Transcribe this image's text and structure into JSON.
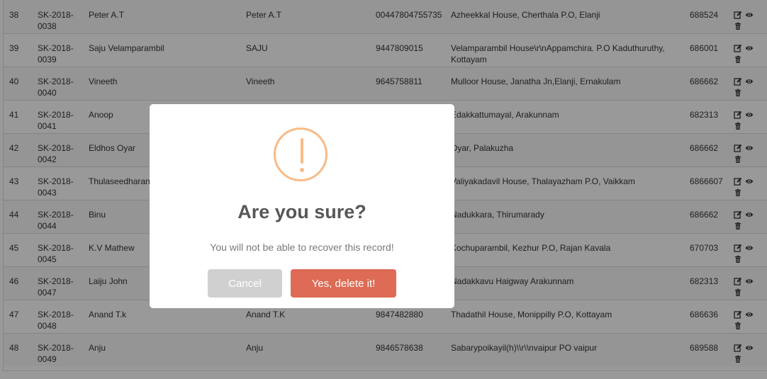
{
  "table": {
    "rows": [
      {
        "no": "38",
        "code": "SK-2018-0038",
        "name": "Peter A.T",
        "nick": "Peter A.T",
        "phone": "00447804755735",
        "address": "Azheekkal House, Cherthala P.O, Elanji",
        "pin": "688524"
      },
      {
        "no": "39",
        "code": "SK-2018-0039",
        "name": "Saju Velamparambil",
        "nick": "SAJU",
        "phone": "9447809015",
        "address": "Velamparambil House\\r\\nAppamchira. P.O Kaduthuruthy, Kottayam",
        "pin": "686001"
      },
      {
        "no": "40",
        "code": "SK-2018-0040",
        "name": "Vineeth",
        "nick": "Vineeth",
        "phone": "9645758811",
        "address": "Mulloor House, Janatha Jn,Elanji, Ernakulam",
        "pin": "686662"
      },
      {
        "no": "41",
        "code": "SK-2018-0041",
        "name": "Anoop",
        "nick": "",
        "phone": "",
        "address": "Edakkattumayal, Arakunnam",
        "pin": "682313"
      },
      {
        "no": "42",
        "code": "SK-2018-0042",
        "name": "Eldhos Oyar",
        "nick": "",
        "phone": "",
        "address": "Oyar, Palakuzha",
        "pin": "686662"
      },
      {
        "no": "43",
        "code": "SK-2018-0043",
        "name": "Thulaseedharan",
        "nick": "",
        "phone": "",
        "address": "Valiyakadavil House, Thalayazham P.O, Vaikkam",
        "pin": "6866607"
      },
      {
        "no": "44",
        "code": "SK-2018-0044",
        "name": "Binu",
        "nick": "",
        "phone": "",
        "address": "Nadukkara, Thirumarady",
        "pin": "686662"
      },
      {
        "no": "45",
        "code": "SK-2018-0045",
        "name": "K.V Mathew",
        "nick": "",
        "phone": "",
        "address": "Kochuparambil, Kezhur P.O, Rajan Kavala",
        "pin": "670703"
      },
      {
        "no": "46",
        "code": "SK-2018-0047",
        "name": "Laiju John",
        "nick": "",
        "phone": "",
        "address": "Nadakkavu Haigway Arakunnam",
        "pin": "682313"
      },
      {
        "no": "47",
        "code": "SK-2018-0048",
        "name": "Anand T.k",
        "nick": "Anand T.K",
        "phone": "9847482880",
        "address": "Thadathil House, Monippilly P.O, Kottayam",
        "pin": "686636"
      },
      {
        "no": "48",
        "code": "SK-2018-0049",
        "name": "Anju",
        "nick": "Anju",
        "phone": "9846578638",
        "address": "Sabarypoikayil(h)\\\\r\\\\nvaipur PO vaipur",
        "pin": "689588"
      }
    ],
    "icons": {
      "edit": "edit-icon",
      "view": "eye-icon",
      "delete": "trash-icon"
    }
  },
  "dialog": {
    "icon": "warning-icon",
    "title": "Are you sure?",
    "message": "You will not be able to recover this record!",
    "cancel_label": "Cancel",
    "confirm_label": "Yes, delete it!"
  },
  "colors": {
    "warning": "#f8bb86",
    "confirm": "#dd6b55",
    "cancel": "#d0d0d0"
  }
}
